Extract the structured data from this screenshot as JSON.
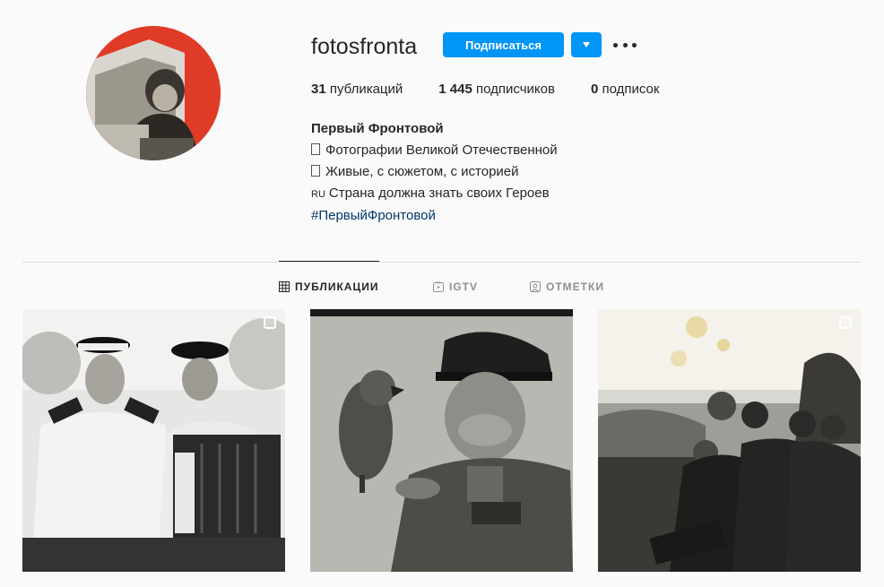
{
  "profile": {
    "username": "fotosfronta",
    "follow_label": "Подписаться",
    "accent_color": "#0095f6",
    "stats": {
      "posts_count": "31",
      "posts_label": "публикаций",
      "followers_count": "1 445",
      "followers_label": "подписчиков",
      "following_count": "0",
      "following_label": "подписок"
    },
    "bio": {
      "name": "Первый Фронтовой",
      "line1": "Фотографии Великой Отечественной",
      "line2": "Живые, с сюжетом, с историей",
      "line3_flag": "RU",
      "line3": "Страна должна знать своих Героев",
      "hashtag": "#ПервыйФронтовой"
    }
  },
  "tabs": [
    {
      "label": "ПУБЛИКАЦИИ",
      "icon": "grid-icon",
      "active": true
    },
    {
      "label": "IGTV",
      "icon": "igtv-icon",
      "active": false
    },
    {
      "label": "ОТМЕТКИ",
      "icon": "tagged-icon",
      "active": false
    }
  ],
  "posts": [
    {
      "icon": "multiple-photos-icon",
      "multi": true
    },
    {
      "icon": "",
      "multi": false
    },
    {
      "icon": "multiple-photos-icon",
      "multi": true
    }
  ]
}
